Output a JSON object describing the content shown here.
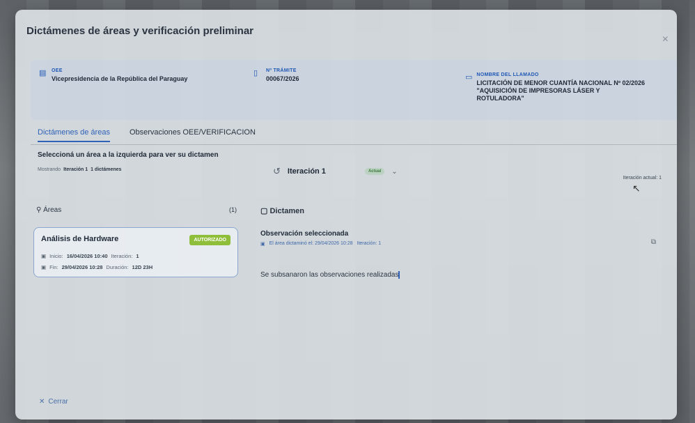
{
  "modal": {
    "title": "Dictámenes de áreas y verificación preliminar",
    "close_icon": "×"
  },
  "info": {
    "oee_label": "OEE",
    "oee_value": "Vicepresidencia de la República del Paraguay",
    "tramite_label": "Nº TRÁMITE",
    "tramite_value": "00067/2026",
    "llamado_label": "NOMBRE DEL LLAMADO",
    "llamado_value": "LICITACIÓN DE MENOR CUANTÍA NACIONAL Nº 02/2026 \"AQUISICIÓN DE IMPRESORAS LÁSER Y ROTULADORA\""
  },
  "tabs": [
    {
      "label": "Dictámenes de áreas"
    },
    {
      "label": "Observaciones OEE/VERIFICACION"
    }
  ],
  "hint": "Seleccioná un área a la izquierda para ver su dictamen",
  "showing": {
    "prefix": "Mostrando",
    "iteration": "Iteración 1",
    "count": "1 dictámenes"
  },
  "iteration_selector": {
    "label": "Iteración 1",
    "badge": "Actual"
  },
  "iteration_current": "Iteración actual: 1",
  "areas": {
    "title": "Áreas",
    "count": "(1)",
    "items": [
      {
        "name": "Análisis de Hardware",
        "status": "AUTORIZADO",
        "start_label": "Inicio:",
        "start_value": "16/04/2026 10:40",
        "iter_label": "Iteración:",
        "iter_value": "1",
        "end_label": "Fin:",
        "end_value": "29/04/2026 10:28",
        "dur_label": "Duración:",
        "dur_value": "12D 23H"
      }
    ]
  },
  "dictamen": {
    "title": "Dictamen",
    "obs_title": "Observación seleccionada",
    "obs_meta": "El área dictaminó el: 29/04/2026 10:28",
    "obs_iter": "Iteración: 1",
    "text": "Se subsanaron las observaciones realizadas"
  },
  "footer": {
    "close_label": "Cerrar"
  },
  "colors": {
    "accent": "#2f62b7",
    "authorized": "#8fbf3a"
  }
}
